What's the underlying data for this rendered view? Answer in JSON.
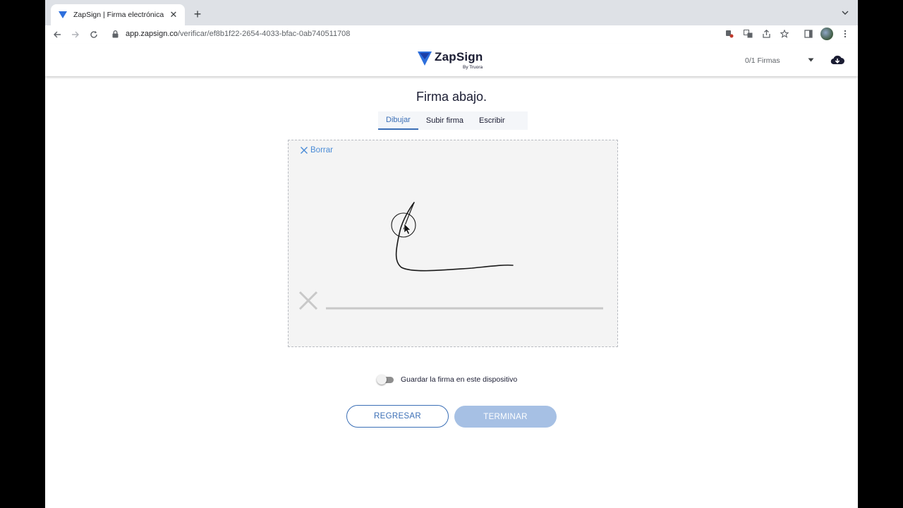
{
  "browser": {
    "tab_title": "ZapSign | Firma electrónica co",
    "tab_close": "✕",
    "new_tab": "+",
    "url_host": "app.zapsign.co",
    "url_path": "/verificar/ef8b1f22-2654-4033-bfac-0ab740511708",
    "icons": [
      "back-icon",
      "forward-icon",
      "reload-icon",
      "lock-icon",
      "extension-icon",
      "translate-icon",
      "share-icon",
      "star-icon",
      "side-panel-icon",
      "profile-avatar",
      "more-menu-icon"
    ]
  },
  "header": {
    "logo_text": "ZapSign",
    "logo_sub": "By Truora",
    "signatures": "0/1 Firmas",
    "brand_color": "#2e6fdc"
  },
  "main": {
    "title": "Firma abajo.",
    "tabs": [
      {
        "label": "Dibujar",
        "active": true
      },
      {
        "label": "Subir firma",
        "active": false
      },
      {
        "label": "Escribir",
        "active": false
      }
    ],
    "clear_label": "Borrar",
    "save_toggle_label": "Guardar la firma en este dispositivo",
    "save_toggle_on": false,
    "back_button": "REGRESAR",
    "finish_button": "TERMINAR",
    "accent_color": "#3b6fb6"
  }
}
